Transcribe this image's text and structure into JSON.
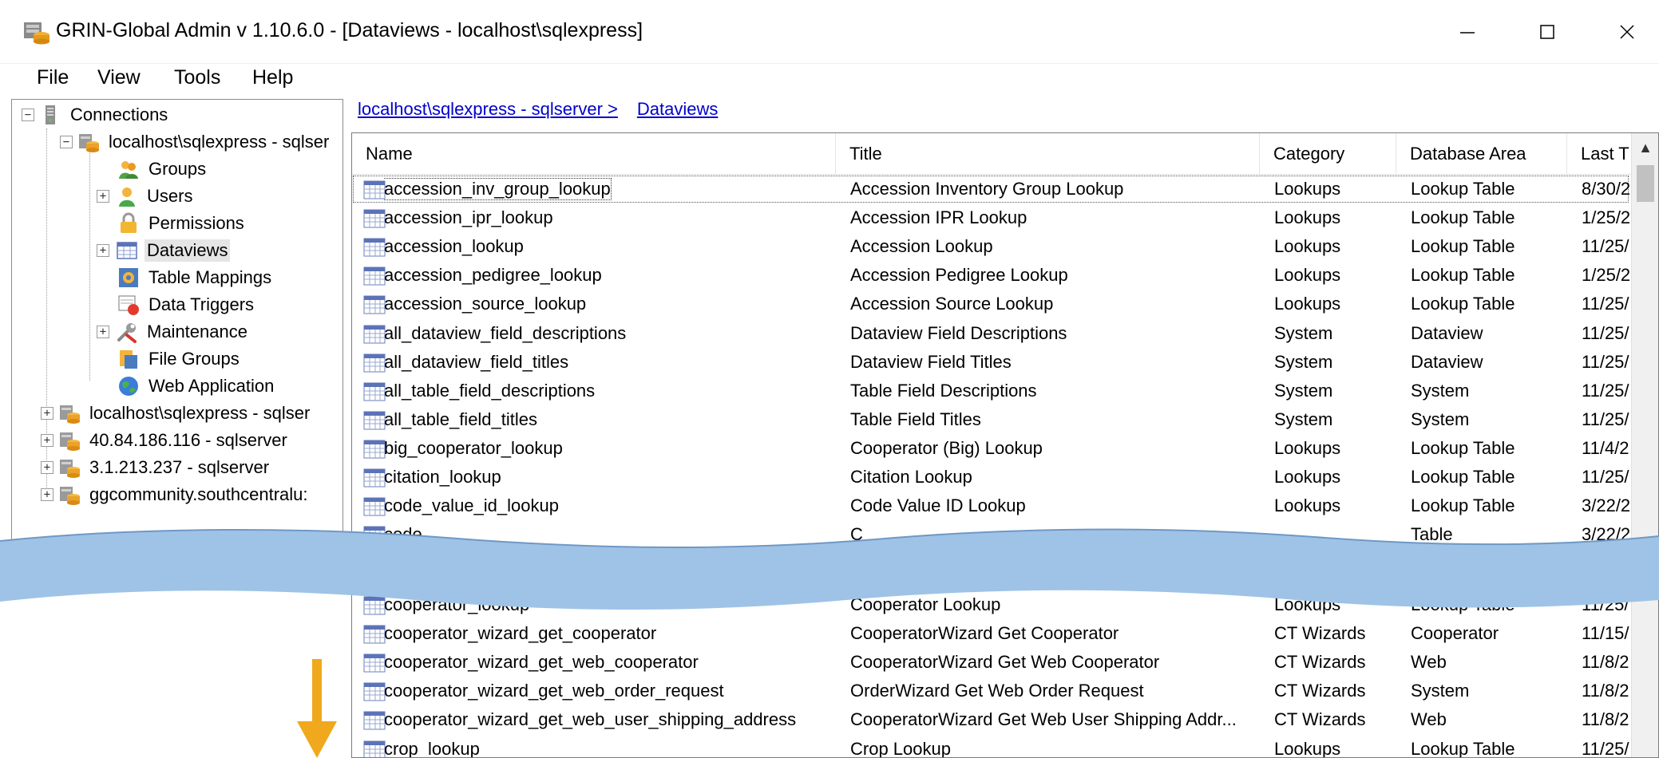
{
  "window": {
    "title": "GRIN-Global Admin v 1.10.6.0 - [Dataviews - localhost\\sqlexpress]",
    "minimize_glyph": "—",
    "maximize_glyph": "☐",
    "close_glyph": "✕"
  },
  "menu": {
    "items": [
      "File",
      "View",
      "Tools",
      "Help"
    ]
  },
  "tree": {
    "root": "Connections",
    "connection": "localhost\\sqlexpress - sqlser",
    "children": [
      "Groups",
      "Users",
      "Permissions",
      "Dataviews",
      "Table Mappings",
      "Data Triggers",
      "Maintenance",
      "File Groups",
      "Web Application"
    ],
    "other_connections": [
      "localhost\\sqlexpress - sqlser",
      "40.84.186.116 - sqlserver",
      "3.1.213.237 - sqlserver",
      "ggcommunity.southcentralu:"
    ],
    "selected": "Dataviews"
  },
  "breadcrumb": {
    "server": "localhost\\sqlexpress - sqlserver >",
    "current": "Dataviews"
  },
  "grid": {
    "columns": [
      "Name",
      "Title",
      "Category",
      "Database Area",
      "Last T"
    ],
    "rows_top": [
      {
        "name": "accession_inv_group_lookup",
        "title": "Accession Inventory Group Lookup",
        "category": "Lookups",
        "area": "Lookup Table",
        "last": "8/30/2"
      },
      {
        "name": "accession_ipr_lookup",
        "title": "Accession IPR Lookup",
        "category": "Lookups",
        "area": "Lookup Table",
        "last": "1/25/2"
      },
      {
        "name": "accession_lookup",
        "title": "Accession Lookup",
        "category": "Lookups",
        "area": "Lookup Table",
        "last": "11/25/"
      },
      {
        "name": "accession_pedigree_lookup",
        "title": "Accession Pedigree Lookup",
        "category": "Lookups",
        "area": "Lookup Table",
        "last": "1/25/2"
      },
      {
        "name": "accession_source_lookup",
        "title": "Accession Source Lookup",
        "category": "Lookups",
        "area": "Lookup Table",
        "last": "11/25/"
      },
      {
        "name": "all_dataview_field_descriptions",
        "title": "Dataview Field Descriptions",
        "category": "System",
        "area": "Dataview",
        "last": "11/25/"
      },
      {
        "name": "all_dataview_field_titles",
        "title": "Dataview Field Titles",
        "category": "System",
        "area": "Dataview",
        "last": "11/25/"
      },
      {
        "name": "all_table_field_descriptions",
        "title": "Table Field Descriptions",
        "category": "System",
        "area": "System",
        "last": "11/25/"
      },
      {
        "name": "all_table_field_titles",
        "title": "Table Field Titles",
        "category": "System",
        "area": "System",
        "last": "11/25/"
      },
      {
        "name": "big_cooperator_lookup",
        "title": "Cooperator (Big) Lookup",
        "category": "Lookups",
        "area": "Lookup Table",
        "last": "11/4/2"
      },
      {
        "name": "citation_lookup",
        "title": "Citation Lookup",
        "category": "Lookups",
        "area": "Lookup Table",
        "last": "11/25/"
      },
      {
        "name": "code_value_id_lookup",
        "title": "Code Value ID Lookup",
        "category": "Lookups",
        "area": "Lookup Table",
        "last": "3/22/2"
      },
      {
        "name": "code",
        "title": "C",
        "category": "",
        "area": "Table",
        "last": "3/22/2"
      }
    ],
    "rows_bottom": [
      {
        "name": "cooperator_lookup",
        "title": "Cooperator Lookup",
        "category": "Lookups",
        "area": "Lookup Table",
        "last": "11/25/"
      },
      {
        "name": "cooperator_wizard_get_cooperator",
        "title": "CooperatorWizard Get Cooperator",
        "category": "CT Wizards",
        "area": "Cooperator",
        "last": "11/15/"
      },
      {
        "name": "cooperator_wizard_get_web_cooperator",
        "title": "CooperatorWizard Get Web Cooperator",
        "category": "CT Wizards",
        "area": "Web",
        "last": "11/8/2"
      },
      {
        "name": "cooperator_wizard_get_web_order_request",
        "title": "OrderWizard Get Web Order Request",
        "category": "CT Wizards",
        "area": "System",
        "last": "11/8/2"
      },
      {
        "name": "cooperator_wizard_get_web_user_shipping_address",
        "title": "CooperatorWizard Get Web User Shipping Addr...",
        "category": "CT Wizards",
        "area": "Web",
        "last": "11/8/2"
      },
      {
        "name": "crop_lookup",
        "title": "Crop Lookup",
        "category": "Lookups",
        "area": "Lookup Table",
        "last": "11/25/"
      }
    ]
  },
  "colors": {
    "wave": "#9ec3e6",
    "arrow": "#f0a81c",
    "link": "#0000cc",
    "selection": "#e5e5e5"
  }
}
